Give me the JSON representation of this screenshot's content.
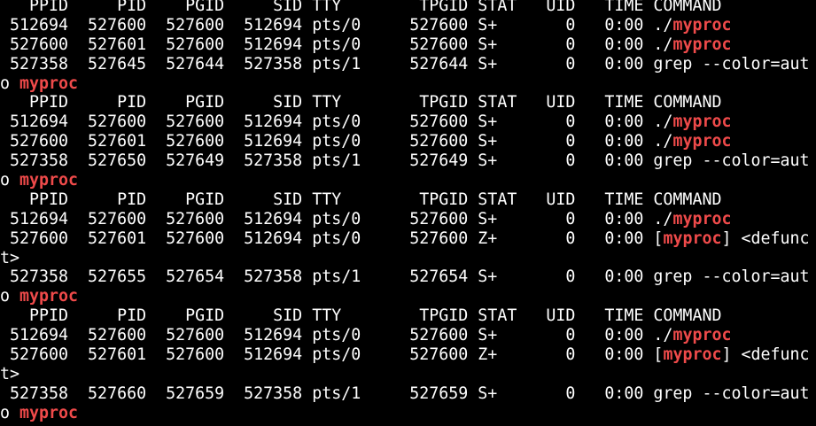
{
  "terminal": {
    "highlight_color": "#ef4a4a",
    "text_color": "#ffffff",
    "background_color": "#000000",
    "lines": [
      [
        {
          "t": "   PPID     PID    PGID     SID TTY        TPGID STAT   UID   TIME COMMAND"
        }
      ],
      [
        {
          "t": " 512694  527600  527600  512694 pts/0     527600 S+       0   0:00 ./"
        },
        {
          "t": "myproc",
          "h": true
        }
      ],
      [
        {
          "t": " 527600  527601  527600  512694 pts/0     527600 S+       0   0:00 ./"
        },
        {
          "t": "myproc",
          "h": true
        }
      ],
      [
        {
          "t": " 527358  527645  527644  527358 pts/1     527644 S+       0   0:00 grep --color=aut"
        }
      ],
      [
        {
          "t": "o "
        },
        {
          "t": "myproc",
          "h": true
        }
      ],
      [
        {
          "t": "   PPID     PID    PGID     SID TTY        TPGID STAT   UID   TIME COMMAND"
        }
      ],
      [
        {
          "t": " 512694  527600  527600  512694 pts/0     527600 S+       0   0:00 ./"
        },
        {
          "t": "myproc",
          "h": true
        }
      ],
      [
        {
          "t": " 527600  527601  527600  512694 pts/0     527600 S+       0   0:00 ./"
        },
        {
          "t": "myproc",
          "h": true
        }
      ],
      [
        {
          "t": " 527358  527650  527649  527358 pts/1     527649 S+       0   0:00 grep --color=aut"
        }
      ],
      [
        {
          "t": "o "
        },
        {
          "t": "myproc",
          "h": true
        }
      ],
      [
        {
          "t": "   PPID     PID    PGID     SID TTY        TPGID STAT   UID   TIME COMMAND"
        }
      ],
      [
        {
          "t": " 512694  527600  527600  512694 pts/0     527600 S+       0   0:00 ./"
        },
        {
          "t": "myproc",
          "h": true
        }
      ],
      [
        {
          "t": " 527600  527601  527600  512694 pts/0     527600 Z+       0   0:00 ["
        },
        {
          "t": "myproc",
          "h": true
        },
        {
          "t": "] <defunc"
        }
      ],
      [
        {
          "t": "t>"
        }
      ],
      [
        {
          "t": " 527358  527655  527654  527358 pts/1     527654 S+       0   0:00 grep --color=aut"
        }
      ],
      [
        {
          "t": "o "
        },
        {
          "t": "myproc",
          "h": true
        }
      ],
      [
        {
          "t": "   PPID     PID    PGID     SID TTY        TPGID STAT   UID   TIME COMMAND"
        }
      ],
      [
        {
          "t": " 512694  527600  527600  512694 pts/0     527600 S+       0   0:00 ./"
        },
        {
          "t": "myproc",
          "h": true
        }
      ],
      [
        {
          "t": " 527600  527601  527600  512694 pts/0     527600 Z+       0   0:00 ["
        },
        {
          "t": "myproc",
          "h": true
        },
        {
          "t": "] <defunc"
        }
      ],
      [
        {
          "t": "t>"
        }
      ],
      [
        {
          "t": " 527358  527660  527659  527358 pts/1     527659 S+       0   0:00 grep --color=aut"
        }
      ],
      [
        {
          "t": "o "
        },
        {
          "t": "myproc",
          "h": true
        }
      ]
    ]
  }
}
